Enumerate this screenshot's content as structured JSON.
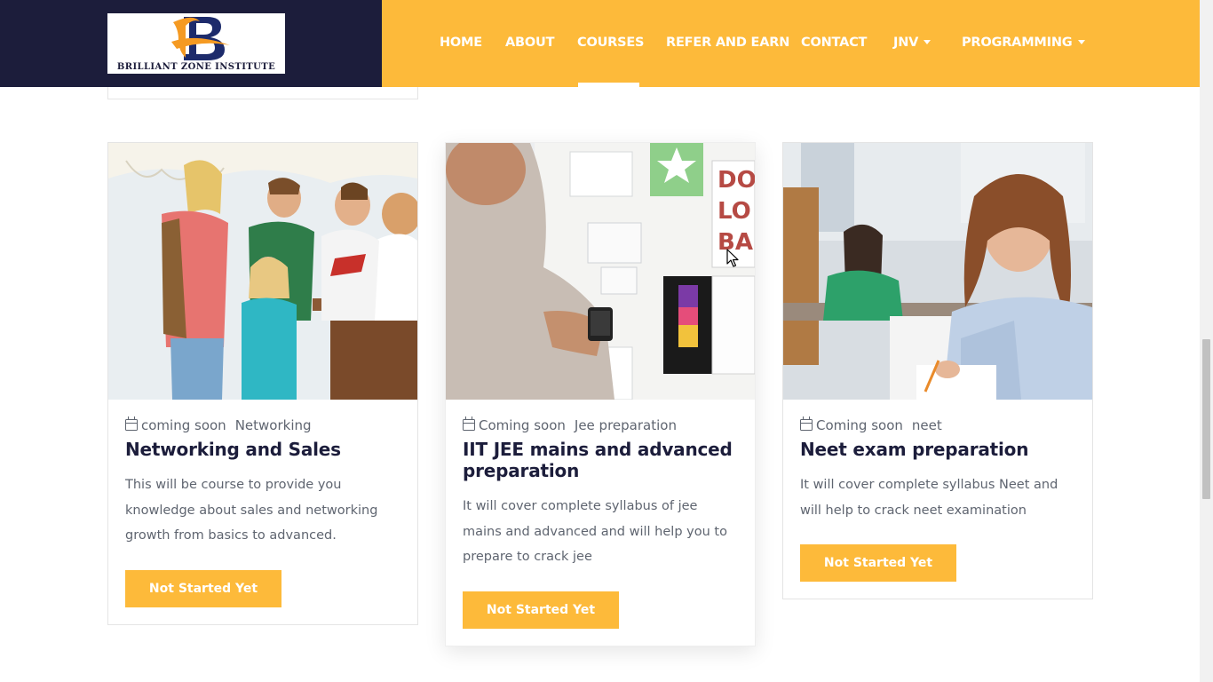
{
  "header": {
    "logo": {
      "letter": "B",
      "name": "BRILLIANT ZONE INSTITUTE",
      "icon": "brilliant-zone-logo"
    },
    "nav": [
      {
        "label": "HOME",
        "dropdown": false,
        "active": false
      },
      {
        "label": "ABOUT",
        "dropdown": false,
        "active": false
      },
      {
        "label": "COURSES",
        "dropdown": false,
        "active": true
      },
      {
        "label": "REFER AND EARN",
        "dropdown": false,
        "active": false
      },
      {
        "label": "CONTACT",
        "dropdown": false,
        "active": false
      },
      {
        "label": "JNV",
        "dropdown": true,
        "active": false
      },
      {
        "label": "PROGRAMMING",
        "dropdown": true,
        "active": false
      }
    ]
  },
  "courses": [
    {
      "image": "students-group-photo",
      "date": "coming soon",
      "category": "Networking",
      "title": "Networking and Sales",
      "description": "This will be course to provide you knowledge about sales and networking growth from basics to advanced.",
      "button": "Not Started Yet"
    },
    {
      "image": "man-with-phone-photo",
      "date": "Coming soon",
      "category": "Jee preparation",
      "title": "IIT JEE mains and advanced preparation",
      "description": "It will cover complete syllabus of jee mains and advanced and will help you to prepare to crack jee",
      "button": "Not Started Yet"
    },
    {
      "image": "student-writing-exam-photo",
      "date": "Coming soon",
      "category": "neet",
      "title": "Neet exam preparation",
      "description": "It will cover complete syllabus Neet and will help to crack neet examination",
      "button": "Not Started Yet"
    }
  ],
  "icons": {
    "calendar": "calendar-icon",
    "caret": "caret-down-icon",
    "cursor": "mouse-pointer-icon"
  },
  "colors": {
    "brand_dark": "#1c1d3b",
    "accent": "#fdba3a",
    "text_muted": "#5f6570",
    "logo_orange": "#f59a22",
    "logo_navy": "#1d2b6b"
  }
}
